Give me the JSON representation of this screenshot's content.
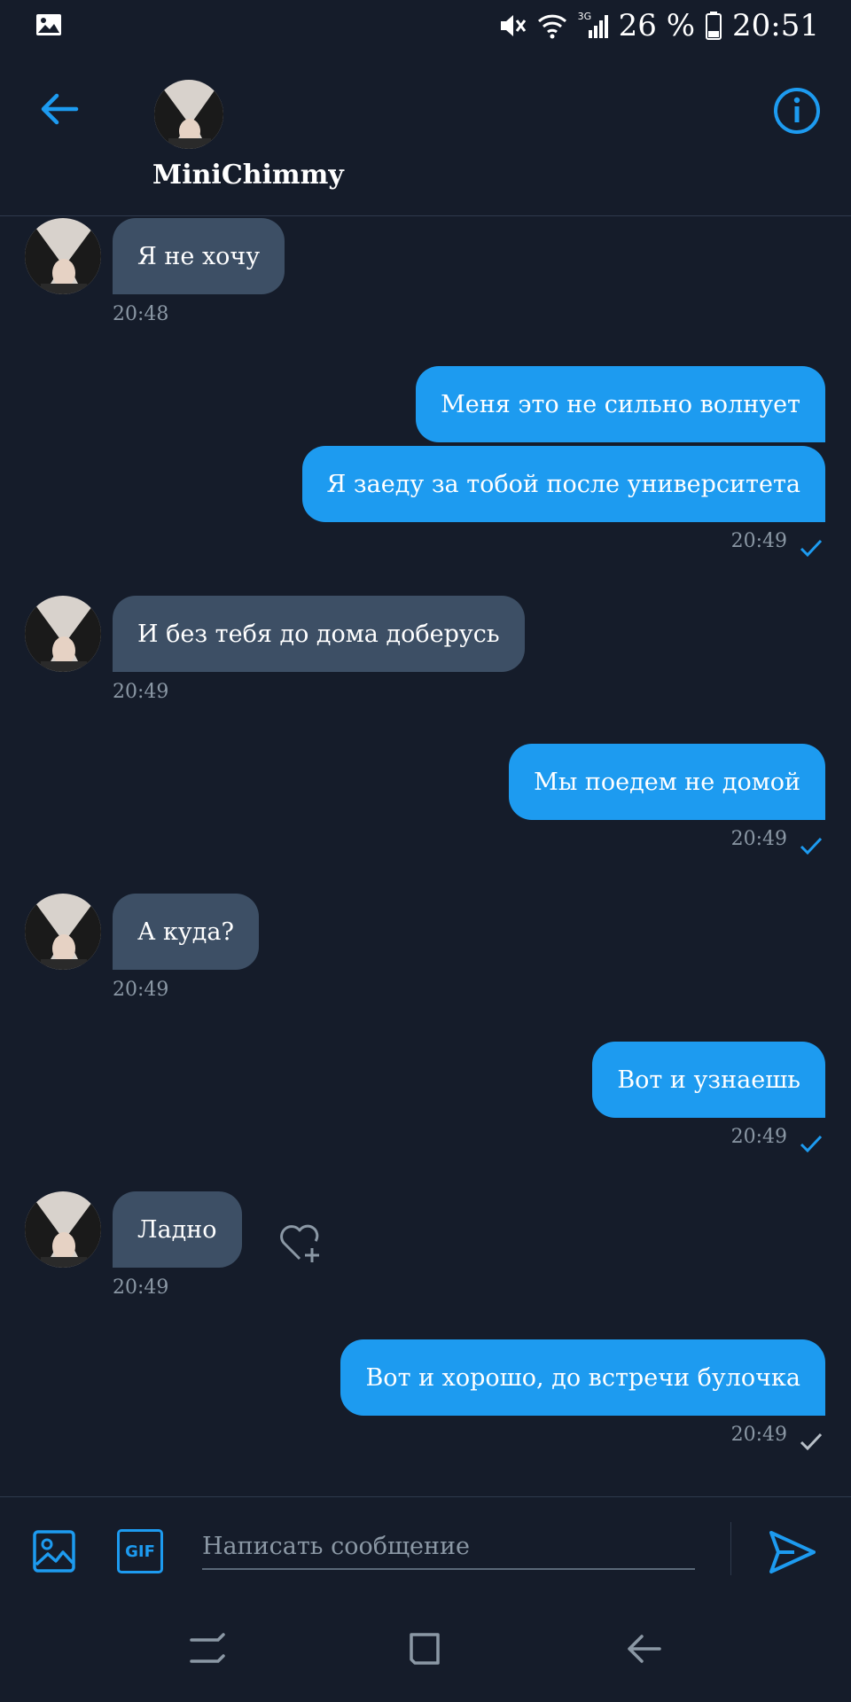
{
  "status_bar": {
    "battery": "26 %",
    "time": "20:51",
    "network_label": "3G",
    "icons": [
      "image-notification-icon",
      "mute-icon",
      "wifi-icon",
      "signal-icon",
      "battery-icon"
    ]
  },
  "header": {
    "contact_name": "MiniChimmy",
    "icons": [
      "back-arrow-icon",
      "info-icon"
    ]
  },
  "messages": [
    {
      "direction": "in",
      "text": "Я не хочу",
      "time": "20:48"
    },
    {
      "direction": "out",
      "text": "Меня это не сильно волнует"
    },
    {
      "direction": "out",
      "text": "Я заеду за тобой после университета",
      "time": "20:49"
    },
    {
      "direction": "in",
      "text": "И без тебя до дома доберусь",
      "time": "20:49"
    },
    {
      "direction": "out",
      "text": "Мы поедем не домой",
      "time": "20:49"
    },
    {
      "direction": "in",
      "text": "А куда?",
      "time": "20:49"
    },
    {
      "direction": "out",
      "text": "Вот и узнаешь",
      "time": "20:49"
    },
    {
      "direction": "in",
      "text": "Ладно",
      "time": "20:49"
    },
    {
      "direction": "out",
      "text": "Вот и хорошо, до встречи булочка",
      "time": "20:49"
    }
  ],
  "composer": {
    "placeholder": "Написать сообщение",
    "gif_label": "GIF",
    "icons": [
      "image-icon",
      "gif-icon",
      "send-icon"
    ]
  },
  "colors": {
    "background": "#151c2a",
    "incoming_bubble": "#3d4f65",
    "outgoing_bubble": "#1d9bf0",
    "accent": "#1d9bf0",
    "timestamp": "#8b98a5"
  }
}
